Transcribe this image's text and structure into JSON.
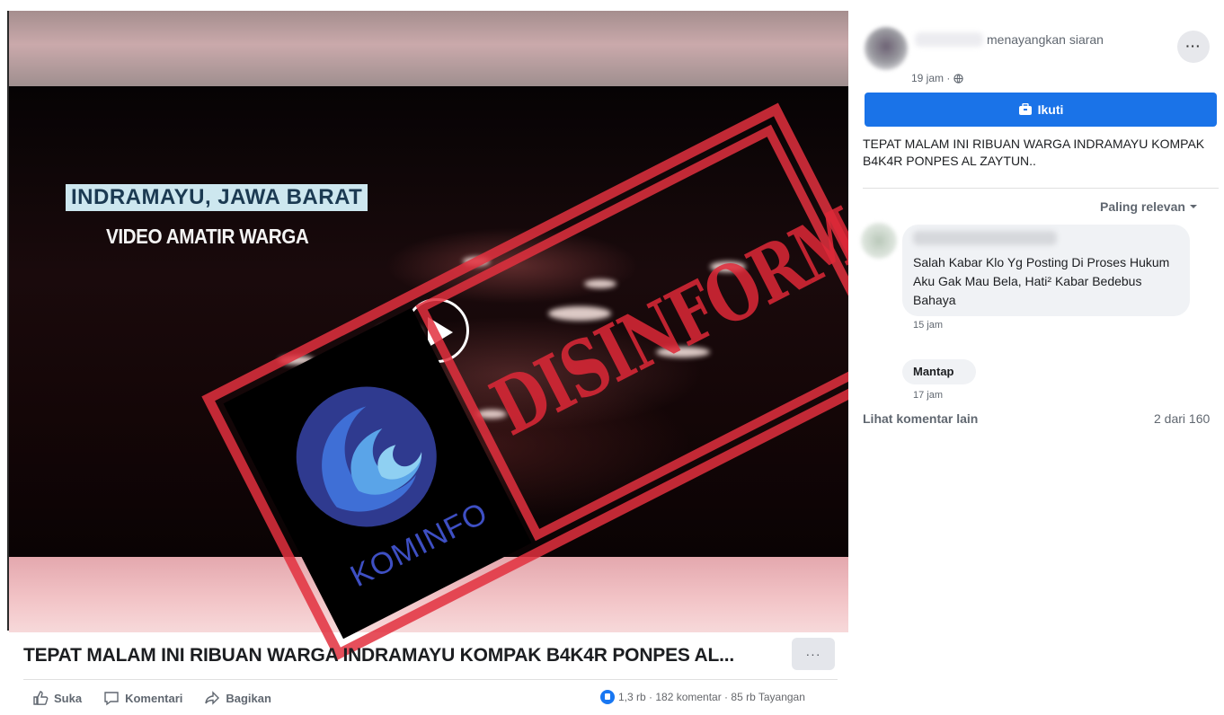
{
  "video": {
    "location_tag": "INDRAMAYU, JAWA BARAT",
    "caption": "VIDEO AMATIR WARGA"
  },
  "stamp": {
    "text": "DISINFORMASI",
    "logo_text": "KOMINFO",
    "color": "#e2303e"
  },
  "post": {
    "title": "TEPAT MALAM INI RIBUAN WARGA INDRAMAYU KOMPAK B4K4R PONPES AL...",
    "more_label": "···",
    "actions": {
      "like": "Suka",
      "comment": "Komentari",
      "share": "Bagikan"
    },
    "stats": "1,3 rb · 182 komentar · 85 rb Tayangan"
  },
  "sidebar": {
    "header_action": "menayangkan siaran",
    "more_label": "···",
    "time": "19 jam ·",
    "follow_label": "Ikuti",
    "post_text": "TEPAT MALAM INI RIBUAN WARGA INDRAMAYU KOMPAK B4K4R PONPES AL ZAYTUN..",
    "sort_label": "Paling relevan",
    "comments": [
      {
        "text": "Salah Kabar Klo Yg Posting Di Proses Hukum Aku Gak Mau Bela, Hati² Kabar Bedebus Bahaya",
        "time": "15 jam"
      },
      {
        "text": "Mantap",
        "time": "17 jam"
      }
    ],
    "more_comments_label": "Lihat komentar lain",
    "comment_count": "2 dari 160"
  },
  "colors": {
    "accent": "#1a73e8",
    "stamp_red": "#e2303e",
    "kominfo_blue": "#3e4fc3"
  }
}
